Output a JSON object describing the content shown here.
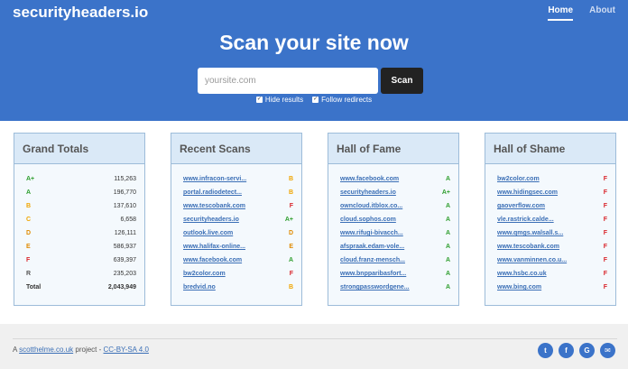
{
  "header": {
    "brand": "securityheaders.io",
    "nav": [
      {
        "label": "Home"
      },
      {
        "label": "About"
      }
    ],
    "headline": "Scan your site now",
    "search": {
      "placeholder": "yoursite.com",
      "button": "Scan"
    },
    "options": {
      "hide_results": "Hide results",
      "follow_redirects": "Follow redirects"
    }
  },
  "colors": {
    "brand_blue": "#3b73c9",
    "grade_a_plus": "#2e9e2e",
    "grade_a": "#2e9e2e",
    "grade_b": "#f0a500",
    "grade_c": "#f0a500",
    "grade_d": "#e08a00",
    "grade_e": "#e08a00",
    "grade_f": "#d9262c",
    "grade_r": "#555555"
  },
  "grand_totals": {
    "title": "Grand Totals",
    "rows": [
      {
        "grade": "A+",
        "count": "115,263"
      },
      {
        "grade": "A",
        "count": "196,770"
      },
      {
        "grade": "B",
        "count": "137,610"
      },
      {
        "grade": "C",
        "count": "6,658"
      },
      {
        "grade": "D",
        "count": "126,111"
      },
      {
        "grade": "E",
        "count": "586,937"
      },
      {
        "grade": "F",
        "count": "639,397"
      },
      {
        "grade": "R",
        "count": "235,203"
      },
      {
        "grade": "Total",
        "count": "2,043,949"
      }
    ]
  },
  "recent_scans": {
    "title": "Recent Scans",
    "rows": [
      {
        "site": "www.infracon-servi...",
        "grade": "B"
      },
      {
        "site": "portal.radiodetect...",
        "grade": "B"
      },
      {
        "site": "www.tescobank.com",
        "grade": "F"
      },
      {
        "site": "securityheaders.io",
        "grade": "A+"
      },
      {
        "site": "outlook.live.com",
        "grade": "D"
      },
      {
        "site": "www.halifax-online...",
        "grade": "E"
      },
      {
        "site": "www.facebook.com",
        "grade": "A"
      },
      {
        "site": "bw2color.com",
        "grade": "F"
      },
      {
        "site": "bredvid.no",
        "grade": "B"
      }
    ]
  },
  "hall_of_fame": {
    "title": "Hall of Fame",
    "rows": [
      {
        "site": "www.facebook.com",
        "grade": "A"
      },
      {
        "site": "securityheaders.io",
        "grade": "A+"
      },
      {
        "site": "owncloud.itblox.co...",
        "grade": "A"
      },
      {
        "site": "cloud.sophos.com",
        "grade": "A"
      },
      {
        "site": "www.rifugi-bivacch...",
        "grade": "A"
      },
      {
        "site": "afspraak.edam-vole...",
        "grade": "A"
      },
      {
        "site": "cloud.franz-mensch...",
        "grade": "A"
      },
      {
        "site": "www.bnpparibasfort...",
        "grade": "A"
      },
      {
        "site": "strongpasswordgene...",
        "grade": "A"
      }
    ]
  },
  "hall_of_shame": {
    "title": "Hall of Shame",
    "rows": [
      {
        "site": "bw2color.com",
        "grade": "F"
      },
      {
        "site": "www.hidingsec.com",
        "grade": "F"
      },
      {
        "site": "gaoverflow.com",
        "grade": "F"
      },
      {
        "site": "vle.rastrick.calde...",
        "grade": "F"
      },
      {
        "site": "www.qmgs.walsall.s...",
        "grade": "F"
      },
      {
        "site": "www.tescobank.com",
        "grade": "F"
      },
      {
        "site": "www.vanminnen.co.u...",
        "grade": "F"
      },
      {
        "site": "www.hsbc.co.uk",
        "grade": "F"
      },
      {
        "site": "www.bing.com",
        "grade": "F"
      }
    ]
  },
  "footer": {
    "prefix": "A ",
    "author_link": "scotthelme.co.uk",
    "middle": " project - ",
    "license_link": "CC-BY-SA 4.0",
    "social": [
      {
        "icon": "twitter-icon",
        "glyph": "t"
      },
      {
        "icon": "facebook-icon",
        "glyph": "f"
      },
      {
        "icon": "google-plus-icon",
        "glyph": "G"
      },
      {
        "icon": "email-icon",
        "glyph": "✉"
      }
    ]
  }
}
